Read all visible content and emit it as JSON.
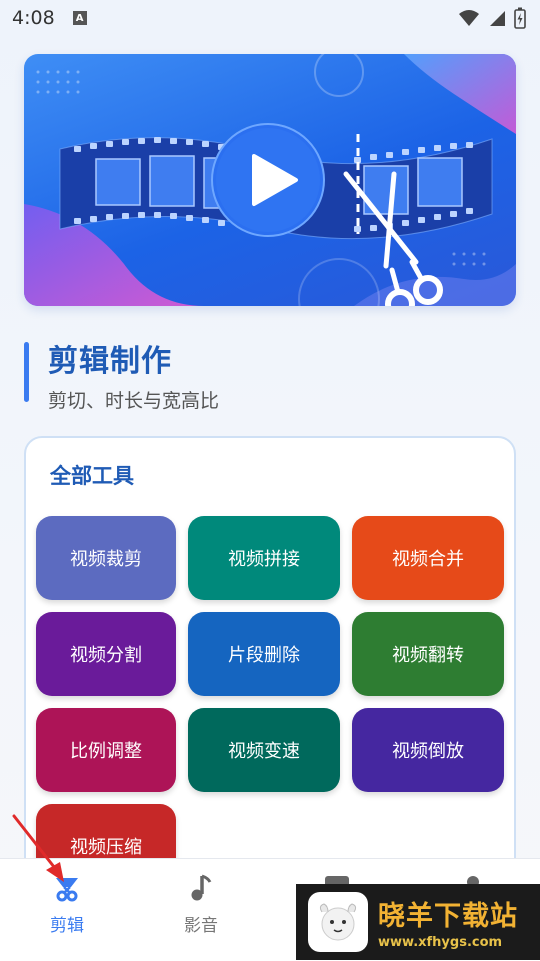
{
  "status_bar": {
    "time": "4:08",
    "notification_icon": "A",
    "icons": [
      "wifi-icon",
      "signal-icon",
      "battery-icon"
    ]
  },
  "banner": {
    "icons": [
      "play-icon",
      "scissors-icon",
      "film-strip"
    ],
    "colors": {
      "primary": "#1c63e6",
      "accent": "#d45ad8"
    }
  },
  "section": {
    "title": "剪辑制作",
    "subtitle": "剪切、时长与宽高比"
  },
  "tools": {
    "title": "全部工具",
    "items": [
      {
        "label": "视频裁剪",
        "color": "#5c6bc0"
      },
      {
        "label": "视频拼接",
        "color": "#00897b"
      },
      {
        "label": "视频合并",
        "color": "#e64a19"
      },
      {
        "label": "视频分割",
        "color": "#6a1b9a"
      },
      {
        "label": "片段删除",
        "color": "#1565c0"
      },
      {
        "label": "视频翻转",
        "color": "#2e7d32"
      },
      {
        "label": "比例调整",
        "color": "#ad1457"
      },
      {
        "label": "视频变速",
        "color": "#00695c"
      },
      {
        "label": "视频倒放",
        "color": "#4527a0"
      },
      {
        "label": "视频压缩",
        "color": "#c62828"
      }
    ]
  },
  "bottom_nav": {
    "items": [
      {
        "label": "剪辑",
        "icon": "scissors-nav-icon",
        "active": true
      },
      {
        "label": "影音",
        "icon": "music-note-icon",
        "active": false
      }
    ],
    "active_color": "#3a7bf0",
    "inactive_color": "#777777"
  },
  "watermark": {
    "name": "晓羊下载站",
    "url": "www.xfhygs.com"
  }
}
